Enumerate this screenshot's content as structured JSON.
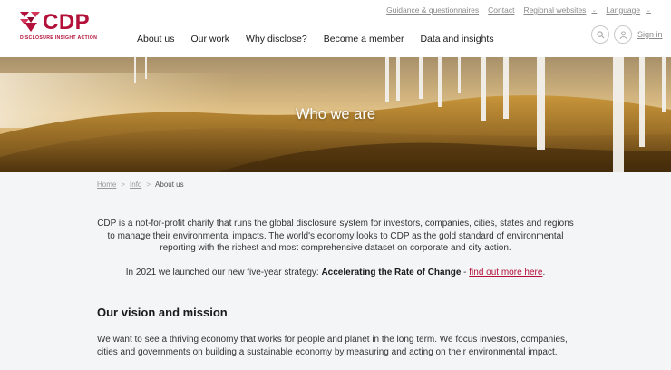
{
  "brand": {
    "name": "CDP",
    "tagline": "DISCLOSURE INSIGHT ACTION",
    "color": "#b3113a"
  },
  "utility_nav": [
    {
      "label": "Guidance & questionnaires",
      "dropdown": false
    },
    {
      "label": "Contact",
      "dropdown": false
    },
    {
      "label": "Regional websites",
      "dropdown": true
    },
    {
      "label": "Language",
      "dropdown": true
    }
  ],
  "main_nav": [
    "About us",
    "Our work",
    "Why disclose?",
    "Become a member",
    "Data and insights"
  ],
  "actions": {
    "search_icon": "search-icon",
    "user_icon": "user-icon",
    "signin": "Sign in"
  },
  "hero": {
    "title": "Who we are"
  },
  "breadcrumb": {
    "items": [
      "Home",
      "Info"
    ],
    "current": "About us",
    "separator": ">"
  },
  "content": {
    "intro": "CDP is a not-for-profit charity that runs the global disclosure system for investors, companies, cities, states and regions to manage their environmental impacts. The world's economy looks to CDP as the gold standard of environmental reporting with the richest and most comprehensive dataset on corporate and city action.",
    "strategy_prefix": "In 2021 we launched our new five-year strategy: ",
    "strategy_bold": "Accelerating the Rate of Change",
    "strategy_dash": " - ",
    "strategy_link": "find out more here",
    "strategy_suffix": ".",
    "vision_heading": "Our vision and mission",
    "vision_text": "We want to see a thriving economy that works for people and planet in the long term. We focus investors, companies, cities and governments on building a sustainable economy by measuring and acting on their environmental impact."
  }
}
